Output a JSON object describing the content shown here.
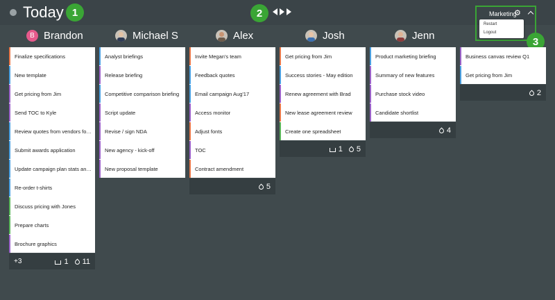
{
  "header": {
    "title": "Today",
    "workspace": "Marketing",
    "menu": [
      "Restart",
      "Logout"
    ],
    "callouts": [
      "1",
      "2",
      "3"
    ]
  },
  "colors": {
    "background": "#404a4d",
    "topbar": "#3b4448",
    "callout": "#3aa535",
    "footer": "#353e41",
    "avatar_initial": "#e75a8c"
  },
  "columns": [
    {
      "name": "Brandon",
      "avatar_initial": "B",
      "tasks": [
        {
          "text": "Finalize specifications",
          "color": "#e8784a"
        },
        {
          "text": "New template",
          "color": "#4a9fe0"
        },
        {
          "text": "Get pricing from Jim",
          "color": "#9b62c9"
        },
        {
          "text": "Send TOC to Kyle",
          "color": "#9b62c9"
        },
        {
          "text": "Review quotes from vendors for t...",
          "color": "#4a9fe0"
        },
        {
          "text": "Submit awards application",
          "color": "#4a9fe0"
        },
        {
          "text": "Update campaign plan stats and f...",
          "color": "#4a9fe0"
        },
        {
          "text": "Re-order t-shirts",
          "color": "#4a9fe0"
        },
        {
          "text": "Discuss pricing with Jones",
          "color": "#5ab55a"
        },
        {
          "text": "Prepare charts",
          "color": "#5ab55a"
        },
        {
          "text": "Brochure graphics",
          "color": "#9b62c9"
        }
      ],
      "footer": {
        "more": "+3",
        "inbox": "1",
        "count": "11"
      }
    },
    {
      "name": "Michael S",
      "tasks": [
        {
          "text": "Analyst briefings",
          "color": "#4a9fe0"
        },
        {
          "text": "Release briefing",
          "color": "#9b62c9"
        },
        {
          "text": "Competitive comparison briefing",
          "color": "#4a9fe0"
        },
        {
          "text": "Script update",
          "color": "#9b62c9"
        },
        {
          "text": "Revise / sign NDA",
          "color": "#9b62c9"
        },
        {
          "text": "New agency - kick-off",
          "color": "#9b62c9"
        },
        {
          "text": "New proposal template",
          "color": "#9b62c9"
        }
      ]
    },
    {
      "name": "Alex",
      "tasks": [
        {
          "text": "Invite Megan's team",
          "color": "#e8784a"
        },
        {
          "text": "Feedback quotes",
          "color": "#4a9fe0"
        },
        {
          "text": "Email campaign Aug'17",
          "color": "#4a9fe0"
        },
        {
          "text": "Access monitor",
          "color": "#9b62c9"
        },
        {
          "text": "Adjust fonts",
          "color": "#e8784a"
        },
        {
          "text": "TOC",
          "color": "#9b62c9"
        },
        {
          "text": "Contract amendment",
          "color": "#e8784a"
        }
      ],
      "footer": {
        "count": "5"
      }
    },
    {
      "name": "Josh",
      "tasks": [
        {
          "text": "Get pricing from Jim",
          "color": "#e8784a"
        },
        {
          "text": "Success stories - May edition",
          "color": "#4a9fe0"
        },
        {
          "text": "Renew agreement with Brad",
          "color": "#9b62c9"
        },
        {
          "text": "New lease agreement review",
          "color": "#e8784a"
        },
        {
          "text": "Create one spreadsheet",
          "color": "#5ab55a"
        }
      ],
      "footer": {
        "inbox": "1",
        "count": "5"
      }
    },
    {
      "name": "Jenn",
      "tasks": [
        {
          "text": "Product marketing briefing",
          "color": "#4a9fe0"
        },
        {
          "text": "Summary of new features",
          "color": "#9b62c9"
        },
        {
          "text": "Purchase stock video",
          "color": "#9b62c9"
        },
        {
          "text": "Candidate shortlist",
          "color": "#9b62c9"
        }
      ],
      "footer": {
        "count": "4"
      }
    },
    {
      "tasks": [
        {
          "text": "Business canvas review Q1",
          "color": "#9b62c9"
        },
        {
          "text": "Get pricing from Jim",
          "color": "#4a9fe0"
        }
      ],
      "footer": {
        "count": "2"
      }
    }
  ]
}
